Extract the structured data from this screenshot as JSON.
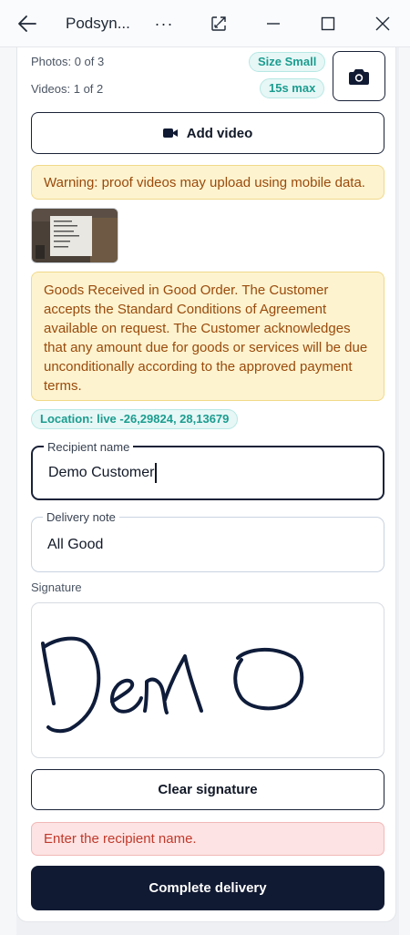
{
  "window": {
    "title": "Podsyn...",
    "more_label": "···"
  },
  "media": {
    "photos_text": "Photos: 0 of 3",
    "photos_badge": "Size Small",
    "videos_text": "Videos: 1 of 2",
    "videos_badge": "15s max",
    "add_video_label": "Add video"
  },
  "warning_text": "Warning: proof videos may upload using mobile data.",
  "terms_text": "Goods Received in Good Order. The Customer accepts the Standard Conditions of Agreement available on request. The Customer acknowledges that any amount due for goods or services will be due unconditionally according to the approved payment terms.",
  "location_badge": "Location: live -26,29824, 28,13679",
  "recipient": {
    "label": "Recipient name",
    "value": "Demo Customer"
  },
  "delivery_note": {
    "label": "Delivery note",
    "value": "All Good"
  },
  "signature": {
    "label": "Signature",
    "signed_text": "Demo",
    "clear_label": "Clear signature"
  },
  "error_text": "Enter the recipient name.",
  "complete_label": "Complete delivery",
  "icons": {
    "back": "arrow-left-icon",
    "more": "more-horizontal-icon",
    "popout": "popout-icon",
    "minimize": "minimize-icon",
    "maximize": "maximize-icon",
    "close": "close-icon",
    "camera": "camera-icon",
    "video": "video-camera-icon"
  },
  "colors": {
    "primary": "#111a33",
    "accent_teal": "#1b9c8f",
    "warning_bg": "#fdf3cf",
    "warning_text": "#9a4a0b",
    "error_bg": "#fde3e3",
    "error_text": "#c0392b",
    "ink": "#0f1c3a"
  }
}
